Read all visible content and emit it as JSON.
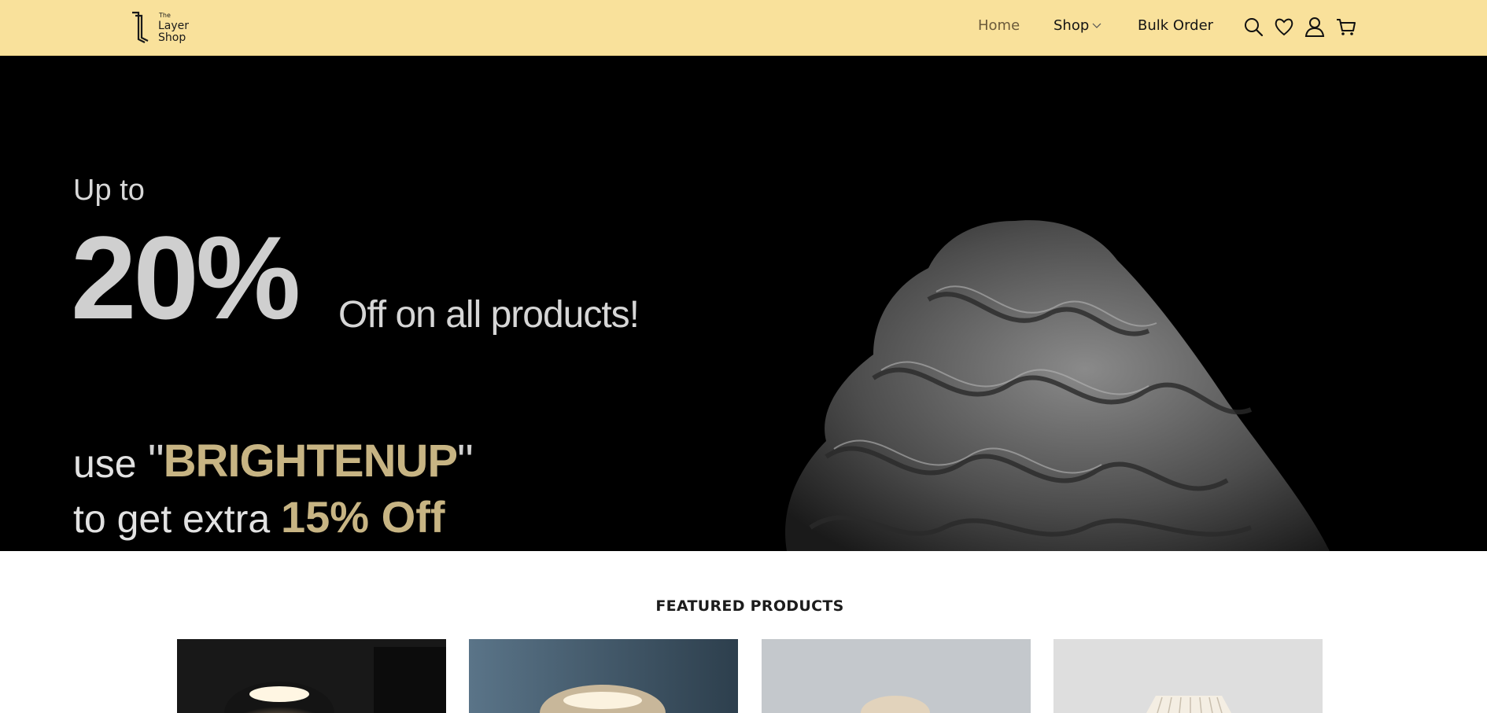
{
  "header": {
    "logo": {
      "the": "The",
      "layer": "Layer",
      "shop": "Shop"
    },
    "nav": {
      "home": "Home",
      "shop": "Shop",
      "bulk_order": "Bulk Order"
    },
    "icons": [
      "search-icon",
      "heart-icon",
      "user-icon",
      "cart-icon"
    ],
    "background_color": "#f9e19b"
  },
  "hero": {
    "up_to": "Up to",
    "percent": "20%",
    "off_text": "Off on all products!",
    "use": "use",
    "code_open_quote": "\"",
    "code": "BRIGHTENUP",
    "code_close_quote": "\"",
    "extra_prefix": "to get extra",
    "extra_value": "15% Off",
    "accent_color": "#c7b483"
  },
  "featured": {
    "title": "FEATURED PRODUCTS"
  }
}
